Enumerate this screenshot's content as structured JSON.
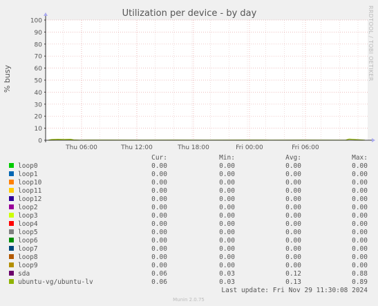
{
  "chart_data": {
    "type": "area",
    "title": "Utilization per device - by day",
    "ylabel": "% busy",
    "xlabel": "",
    "ylim": [
      0,
      100
    ],
    "y_ticks": [
      0,
      10,
      20,
      30,
      40,
      50,
      60,
      70,
      80,
      90,
      100
    ],
    "x_ticks": [
      "Thu 06:00",
      "Thu 12:00",
      "Thu 18:00",
      "Fri 00:00",
      "Fri 06:00"
    ],
    "grid": true,
    "side_label": "RRDTOOL / TOBI OETIKER",
    "stats_headers": [
      "Cur:",
      "Min:",
      "Avg:",
      "Max:"
    ],
    "series": [
      {
        "name": "loop0",
        "color": "#00cc00",
        "cur": "0.00",
        "min": "0.00",
        "avg": "0.00",
        "max": "0.00"
      },
      {
        "name": "loop1",
        "color": "#0066b3",
        "cur": "0.00",
        "min": "0.00",
        "avg": "0.00",
        "max": "0.00"
      },
      {
        "name": "loop10",
        "color": "#ff8000",
        "cur": "0.00",
        "min": "0.00",
        "avg": "0.00",
        "max": "0.00"
      },
      {
        "name": "loop11",
        "color": "#ffcc00",
        "cur": "0.00",
        "min": "0.00",
        "avg": "0.00",
        "max": "0.00"
      },
      {
        "name": "loop12",
        "color": "#330099",
        "cur": "0.00",
        "min": "0.00",
        "avg": "0.00",
        "max": "0.00"
      },
      {
        "name": "loop2",
        "color": "#990099",
        "cur": "0.00",
        "min": "0.00",
        "avg": "0.00",
        "max": "0.00"
      },
      {
        "name": "loop3",
        "color": "#ccff00",
        "cur": "0.00",
        "min": "0.00",
        "avg": "0.00",
        "max": "0.00"
      },
      {
        "name": "loop4",
        "color": "#ff0000",
        "cur": "0.00",
        "min": "0.00",
        "avg": "0.00",
        "max": "0.00"
      },
      {
        "name": "loop5",
        "color": "#808080",
        "cur": "0.00",
        "min": "0.00",
        "avg": "0.00",
        "max": "0.00"
      },
      {
        "name": "loop6",
        "color": "#008f00",
        "cur": "0.00",
        "min": "0.00",
        "avg": "0.00",
        "max": "0.00"
      },
      {
        "name": "loop7",
        "color": "#00487d",
        "cur": "0.00",
        "min": "0.00",
        "avg": "0.00",
        "max": "0.00"
      },
      {
        "name": "loop8",
        "color": "#b35a00",
        "cur": "0.00",
        "min": "0.00",
        "avg": "0.00",
        "max": "0.00"
      },
      {
        "name": "loop9",
        "color": "#b38f00",
        "cur": "0.00",
        "min": "0.00",
        "avg": "0.00",
        "max": "0.00"
      },
      {
        "name": "sda",
        "color": "#6b006b",
        "cur": "0.06",
        "min": "0.03",
        "avg": "0.12",
        "max": "0.88"
      },
      {
        "name": "ubuntu-vg/ubuntu-lv",
        "color": "#8fb300",
        "cur": "0.06",
        "min": "0.03",
        "avg": "0.13",
        "max": "0.89"
      }
    ],
    "activity": {
      "series": "ubuntu-vg/ubuntu-lv",
      "t": [
        0,
        0.01,
        0.03,
        0.05,
        0.07,
        0.08,
        0.1,
        0.2,
        0.3,
        0.4,
        0.5,
        0.6,
        0.7,
        0.8,
        0.9,
        0.94,
        0.95,
        1
      ],
      "values": [
        0.1,
        0.6,
        0.8,
        0.7,
        0.8,
        0.3,
        0.1,
        0.2,
        0.1,
        0.15,
        0.1,
        0.15,
        0.1,
        0.15,
        0.1,
        0.2,
        0.9,
        0.1
      ]
    },
    "last_update": "Last update: Fri Nov 29 11:30:08 2024",
    "footer": "Munin 2.0.75"
  }
}
